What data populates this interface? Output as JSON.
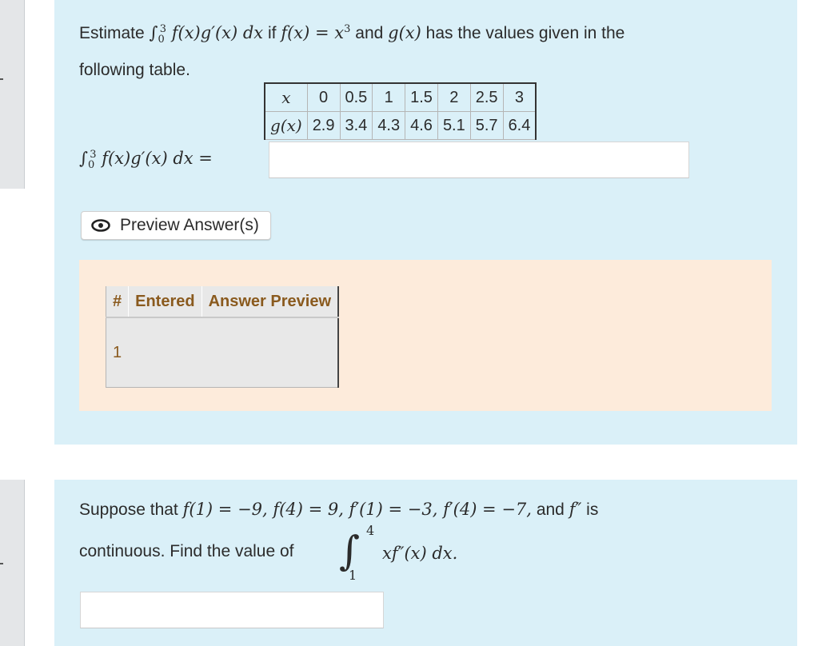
{
  "problem1": {
    "statement_prefix": "Estimate",
    "integral_upper": "3",
    "integral_lower": "0",
    "integrand": "f(x)g′(x) dx",
    "if_word": "if",
    "f_def": "f(x) = x",
    "f_exp": "3",
    "and_word": "and",
    "g_name": "g(x)",
    "statement_suffix": "has the values given in the",
    "statement_line2": "following table.",
    "table": {
      "row_x_label": "x",
      "row_g_label": "g(x)",
      "x_values": [
        "0",
        "0.5",
        "1",
        "1.5",
        "2",
        "2.5",
        "3"
      ],
      "g_values": [
        "2.9",
        "3.4",
        "4.3",
        "4.6",
        "5.1",
        "5.7",
        "6.4"
      ]
    },
    "answer_label_upper": "3",
    "answer_label_lower": "0",
    "answer_label_expr": "f(x)g′(x) dx =",
    "answer_value": "",
    "preview_button_label": "Preview Answer(s)",
    "preview_icon": "eye-icon",
    "results": {
      "headers": [
        "#",
        "Entered",
        "Answer Preview"
      ],
      "rows": [
        [
          "1",
          "",
          ""
        ]
      ]
    }
  },
  "problem2": {
    "line1_text": "Suppose that",
    "line1_math": "f(1) = −9,  f(4) = 9,  f′(1) = −3,  f′(4) = −7,",
    "line1_and": "and",
    "line1_fpp": "f″",
    "line1_is": "is",
    "line2_text": "continuous. Find the value of",
    "integral_upper": "4",
    "integral_lower": "1",
    "integrand": "xf″(x) dx.",
    "answer_value": ""
  },
  "colors": {
    "problem_bg": "#daf0f8",
    "results_bg": "#fdebdb",
    "results_header_text": "#8a5a1e",
    "side_tab_bg": "#e4e6e8"
  }
}
